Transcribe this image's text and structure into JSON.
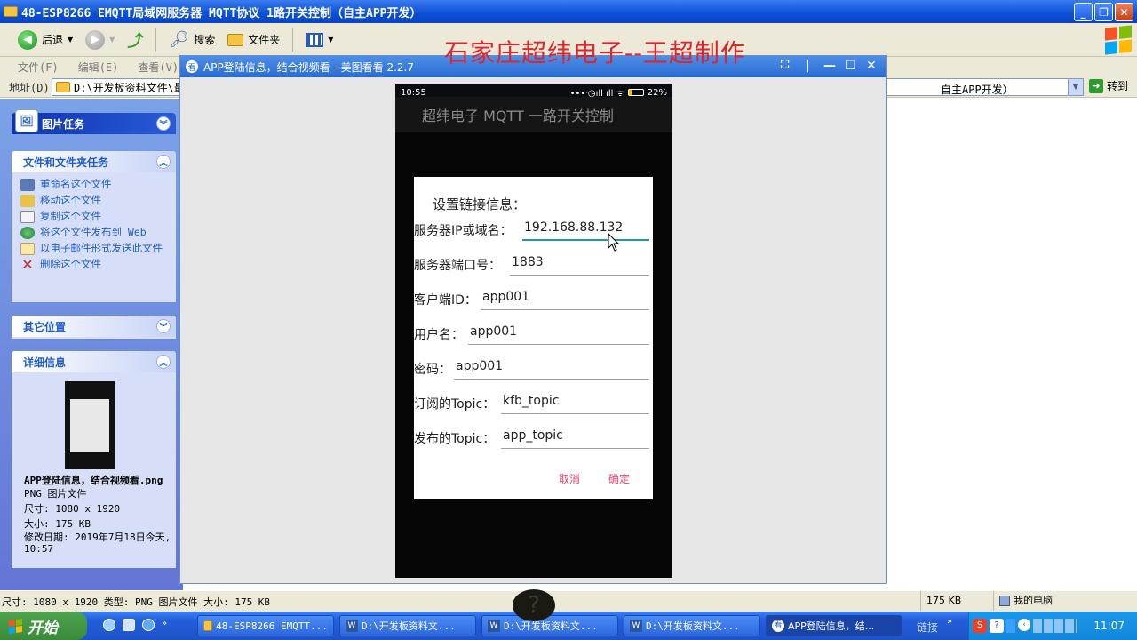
{
  "explorer": {
    "title": "48-ESP8266 EMQTT局域网服务器 MQTT协议 1路开关控制（自主APP开发）",
    "toolbar": {
      "back": "后退",
      "search": "搜索",
      "folders": "文件夹"
    },
    "menu": [
      "文件(F)",
      "编辑(E)",
      "查看(V)",
      "收"
    ],
    "address_label": "地址(D)",
    "address_value": "D:\\开发板资料文件\\最",
    "address_tail": "自主APP开发）",
    "go": "转到"
  },
  "overlay_title": "石家庄超纬电子--王超制作",
  "taskpane": {
    "picture_tasks": "图片任务",
    "file_tasks": {
      "title": "文件和文件夹任务",
      "items": [
        "重命名这个文件",
        "移动这个文件",
        "复制这个文件",
        "将这个文件发布到 Web",
        "以电子邮件形式发送此文件",
        "删除这个文件"
      ]
    },
    "other_places": "其它位置",
    "details": {
      "title": "详细信息",
      "filename": "APP登陆信息，结合视频看.png",
      "type": "PNG 图片文件",
      "dimensions": "尺寸: 1080 x 1920",
      "size": "大小: 175 KB",
      "modified": "修改日期: 2019年7月18日今天, 10:57"
    }
  },
  "viewer": {
    "title": "APP登陆信息，结合视频看 - 美图看看 2.2.7"
  },
  "phone": {
    "time": "10:55",
    "battery": "22%",
    "app_title": "超纬电子 MQTT 一路开关控制",
    "dialog": {
      "title": "设置链接信息：",
      "fields": [
        {
          "label": "服务器IP或域名：",
          "value": "192.168.88.132"
        },
        {
          "label": "服务器端口号：",
          "value": "1883"
        },
        {
          "label": "客户端ID：",
          "value": "app001"
        },
        {
          "label": "用户名：",
          "value": "app001"
        },
        {
          "label": "密码：",
          "value": "app001"
        },
        {
          "label": "订阅的Topic：",
          "value": "kfb_topic"
        },
        {
          "label": "发布的Topic：",
          "value": "app_topic"
        }
      ],
      "cancel": "取消",
      "ok": "确定"
    },
    "help_glyph": "?"
  },
  "statusbar": {
    "left": "尺寸: 1080 x 1920 类型: PNG 图片文件 大小: 175 KB",
    "size": "175 KB",
    "computer": "我的电脑"
  },
  "taskbar": {
    "start": "开始",
    "buttons": [
      "48-ESP8266 EMQTT...",
      "D:\\开发板资料文...",
      "D:\\开发板资料文...",
      "D:\\开发板资料文...",
      "APP登陆信息，结..."
    ],
    "links": "链接",
    "clock": "11:07"
  },
  "colors": {
    "xp_blue": "#0b4fd6",
    "overlay_red": "#e0242a",
    "accent_teal": "#1b9e8e",
    "button_pink": "#e8446b"
  }
}
